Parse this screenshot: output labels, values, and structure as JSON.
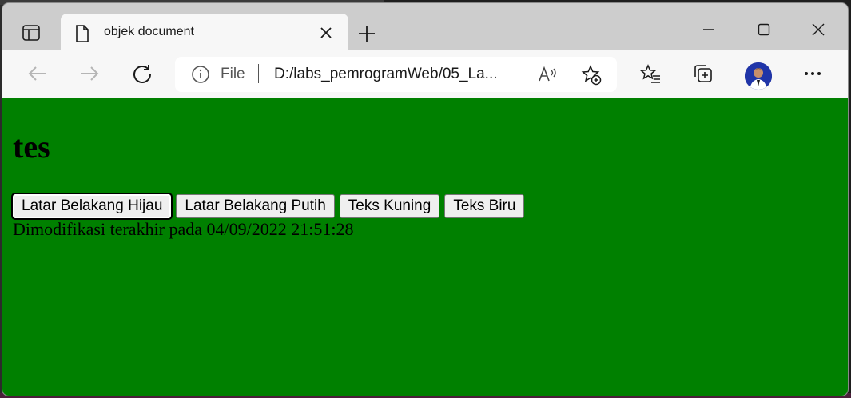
{
  "browser": {
    "tab_title": "objek document",
    "omnibox": {
      "scheme_label": "File",
      "url": "D:/labs_pemrogramWeb/05_La..."
    },
    "read_aloud_label": "A⁾"
  },
  "page": {
    "heading": "tes",
    "buttons": [
      {
        "label": "Latar Belakang Hijau"
      },
      {
        "label": "Latar Belakang Putih"
      },
      {
        "label": "Teks Kuning"
      },
      {
        "label": "Teks Biru"
      }
    ],
    "modified_text": "Dimodifikasi terakhir pada 04/09/2022 21:51:28",
    "background_color": "#008000"
  },
  "icons": [
    "tab-actions-icon",
    "page-icon",
    "close-icon",
    "new-tab-icon",
    "minimize-icon",
    "maximize-icon",
    "window-close-icon",
    "back-icon",
    "forward-icon",
    "refresh-icon",
    "info-icon",
    "read-aloud-icon",
    "add-favorite-icon",
    "favorites-icon",
    "collections-icon",
    "avatar",
    "more-icon"
  ]
}
